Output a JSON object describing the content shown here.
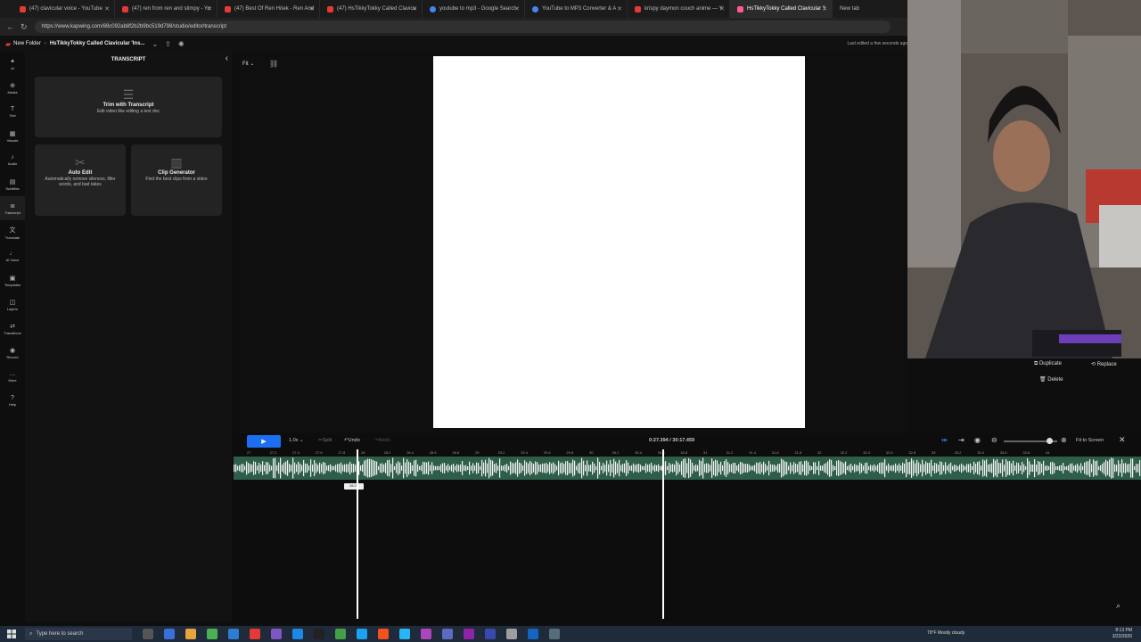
{
  "browser": {
    "tabs": [
      {
        "title": "(47) clavicular voice - YouTube",
        "favicon": "youtube-icon"
      },
      {
        "title": "(47) ren from ren and stimpy - Yo",
        "favicon": "youtube-icon"
      },
      {
        "title": "(47) Best Of Ren Höek - Ren And",
        "favicon": "youtube-icon"
      },
      {
        "title": "(47) HsTikkyTokky Called Clavicu",
        "favicon": "youtube-icon"
      },
      {
        "title": "youtube to mp3 - Google Search",
        "favicon": "google-icon"
      },
      {
        "title": "YouTube to MP3 Converter & A",
        "favicon": "converter-icon"
      },
      {
        "title": "krispy daymon couch anime — Y",
        "favicon": "youtube-icon"
      },
      {
        "title": "HsTikkyTokky Called Clavicular 'I",
        "favicon": "kapwing-icon",
        "active": true
      }
    ],
    "new_tab_label": "New tab",
    "url": "https://www.kapwing.com/69c092ab8f2b2b9bc519d798/studio/editor/transcript"
  },
  "app": {
    "breadcrumb_folder": "New Folder",
    "project_title": "HsTikkyTokky Called Clavicular 'Ins...",
    "last_edited": "Last edited a few seconds ago"
  },
  "rail": [
    {
      "label": "AI",
      "icon": "sparkle-icon"
    },
    {
      "label": "Media",
      "icon": "plus-icon"
    },
    {
      "label": "Text",
      "icon": "text-icon"
    },
    {
      "label": "Visuals",
      "icon": "grid-icon"
    },
    {
      "label": "Audio",
      "icon": "music-icon"
    },
    {
      "label": "Subtitles",
      "icon": "subtitles-icon"
    },
    {
      "label": "Transcript",
      "icon": "transcript-icon",
      "active": true
    },
    {
      "label": "Translate",
      "icon": "translate-icon"
    },
    {
      "label": "AI Voice",
      "icon": "microphone-icon"
    },
    {
      "label": "Templates",
      "icon": "template-icon"
    },
    {
      "label": "Layers",
      "icon": "layers-icon"
    },
    {
      "label": "Transitions",
      "icon": "transitions-icon"
    },
    {
      "label": "Record",
      "icon": "record-icon"
    },
    {
      "label": "More",
      "icon": "more-icon"
    },
    {
      "label": "Help",
      "icon": "help-icon"
    }
  ],
  "panel": {
    "title": "TRANSCRIPT",
    "trim": {
      "title": "Trim with Transcript",
      "subtitle": "Edit video like editing a text doc"
    },
    "auto_edit": {
      "title": "Auto Edit",
      "subtitle": "Automatically remove silences, filler words, and bad takes"
    },
    "clip_gen": {
      "title": "Clip Generator",
      "subtitle": "Find the best clips from a video"
    }
  },
  "stage": {
    "fit_label": "Fit"
  },
  "props": {
    "duplicate": "Duplicate",
    "replace": "Replace",
    "delete": "Delete"
  },
  "timeline": {
    "speed": "1.0x",
    "split": "Split",
    "undo": "Undo",
    "redo": "Redo",
    "time": "0:27.394 / 30:17.459",
    "fit_to_screen": "Fit to Screen",
    "ruler_ticks": [
      "27",
      "27.2",
      "27.4",
      "27.6",
      "27.8",
      "28",
      "28.2",
      "28.4",
      "28.6",
      "28.8",
      "29",
      "29.2",
      "29.4",
      "29.6",
      "29.8",
      "30",
      "30.2",
      "30.4",
      "30.6",
      "30.8",
      "31",
      "31.2",
      "31.4",
      "31.6",
      "31.8",
      "32",
      "32.2",
      "32.4",
      "32.6",
      "32.8",
      "33",
      "33.2",
      "33.4",
      "33.6",
      "33.8",
      "34"
    ],
    "drag_tooltip": "28.07"
  },
  "taskbar": {
    "search_placeholder": "Type here to search",
    "weather": "79°F  Mostly cloudy",
    "time": "8:13 PM",
    "date": "3/22/2026"
  },
  "colors": {
    "accent": "#1d6ff2",
    "track": "#2e5e4a"
  }
}
